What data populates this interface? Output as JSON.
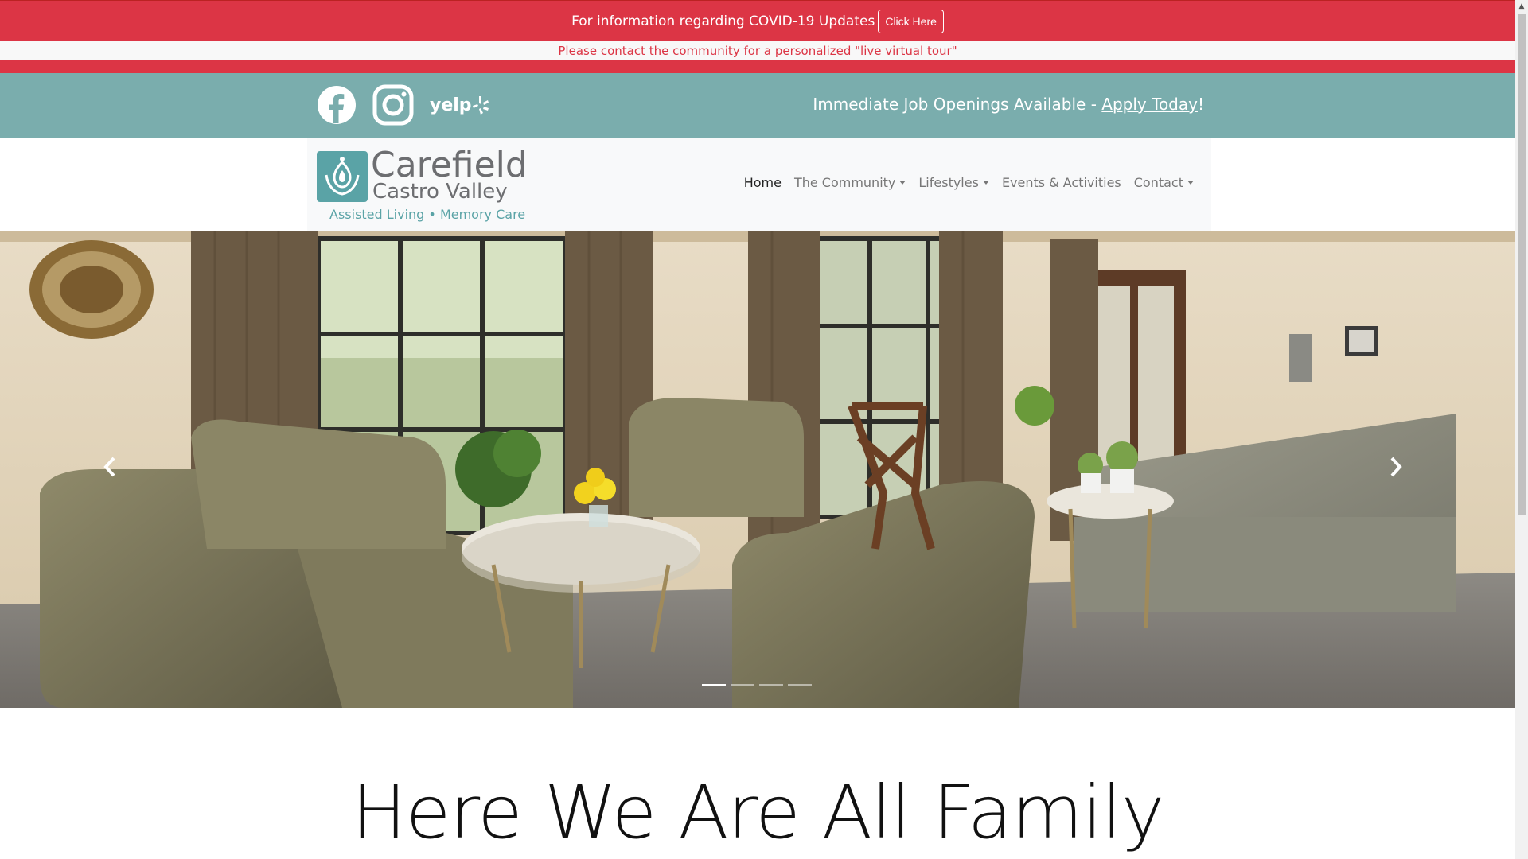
{
  "covid": {
    "message": "For information regarding COVID-19 Updates",
    "button_label": "Click Here"
  },
  "tour": {
    "message": "Please contact the community for a personalized \"live virtual tour\""
  },
  "social": {
    "icons": [
      "facebook-icon",
      "instagram-icon",
      "yelp-icon"
    ],
    "yelp_text": "yelp",
    "job_prefix": "Immediate Job Openings Available - ",
    "job_link": "Apply Today",
    "job_suffix": "!"
  },
  "logo": {
    "name": "Carefield",
    "location": "Castro Valley",
    "tagline": "Assisted Living • Memory Care"
  },
  "nav": {
    "items": [
      {
        "label": "Home",
        "active": true,
        "dropdown": false
      },
      {
        "label": "The Community",
        "active": false,
        "dropdown": true
      },
      {
        "label": "Lifestyles",
        "active": false,
        "dropdown": true
      },
      {
        "label": "Events & Activities",
        "active": false,
        "dropdown": false
      },
      {
        "label": "Contact",
        "active": false,
        "dropdown": true
      }
    ]
  },
  "carousel": {
    "slide_count": 4,
    "active_index": 0,
    "prev_icon": "chevron-left-icon",
    "next_icon": "chevron-right-icon"
  },
  "main": {
    "headline": "Here We Are All Family"
  },
  "colors": {
    "alert_red": "#dc3545",
    "teal": "#7aadad",
    "logo_teal": "#5aa3a6",
    "logo_gray": "#6d6e71"
  }
}
